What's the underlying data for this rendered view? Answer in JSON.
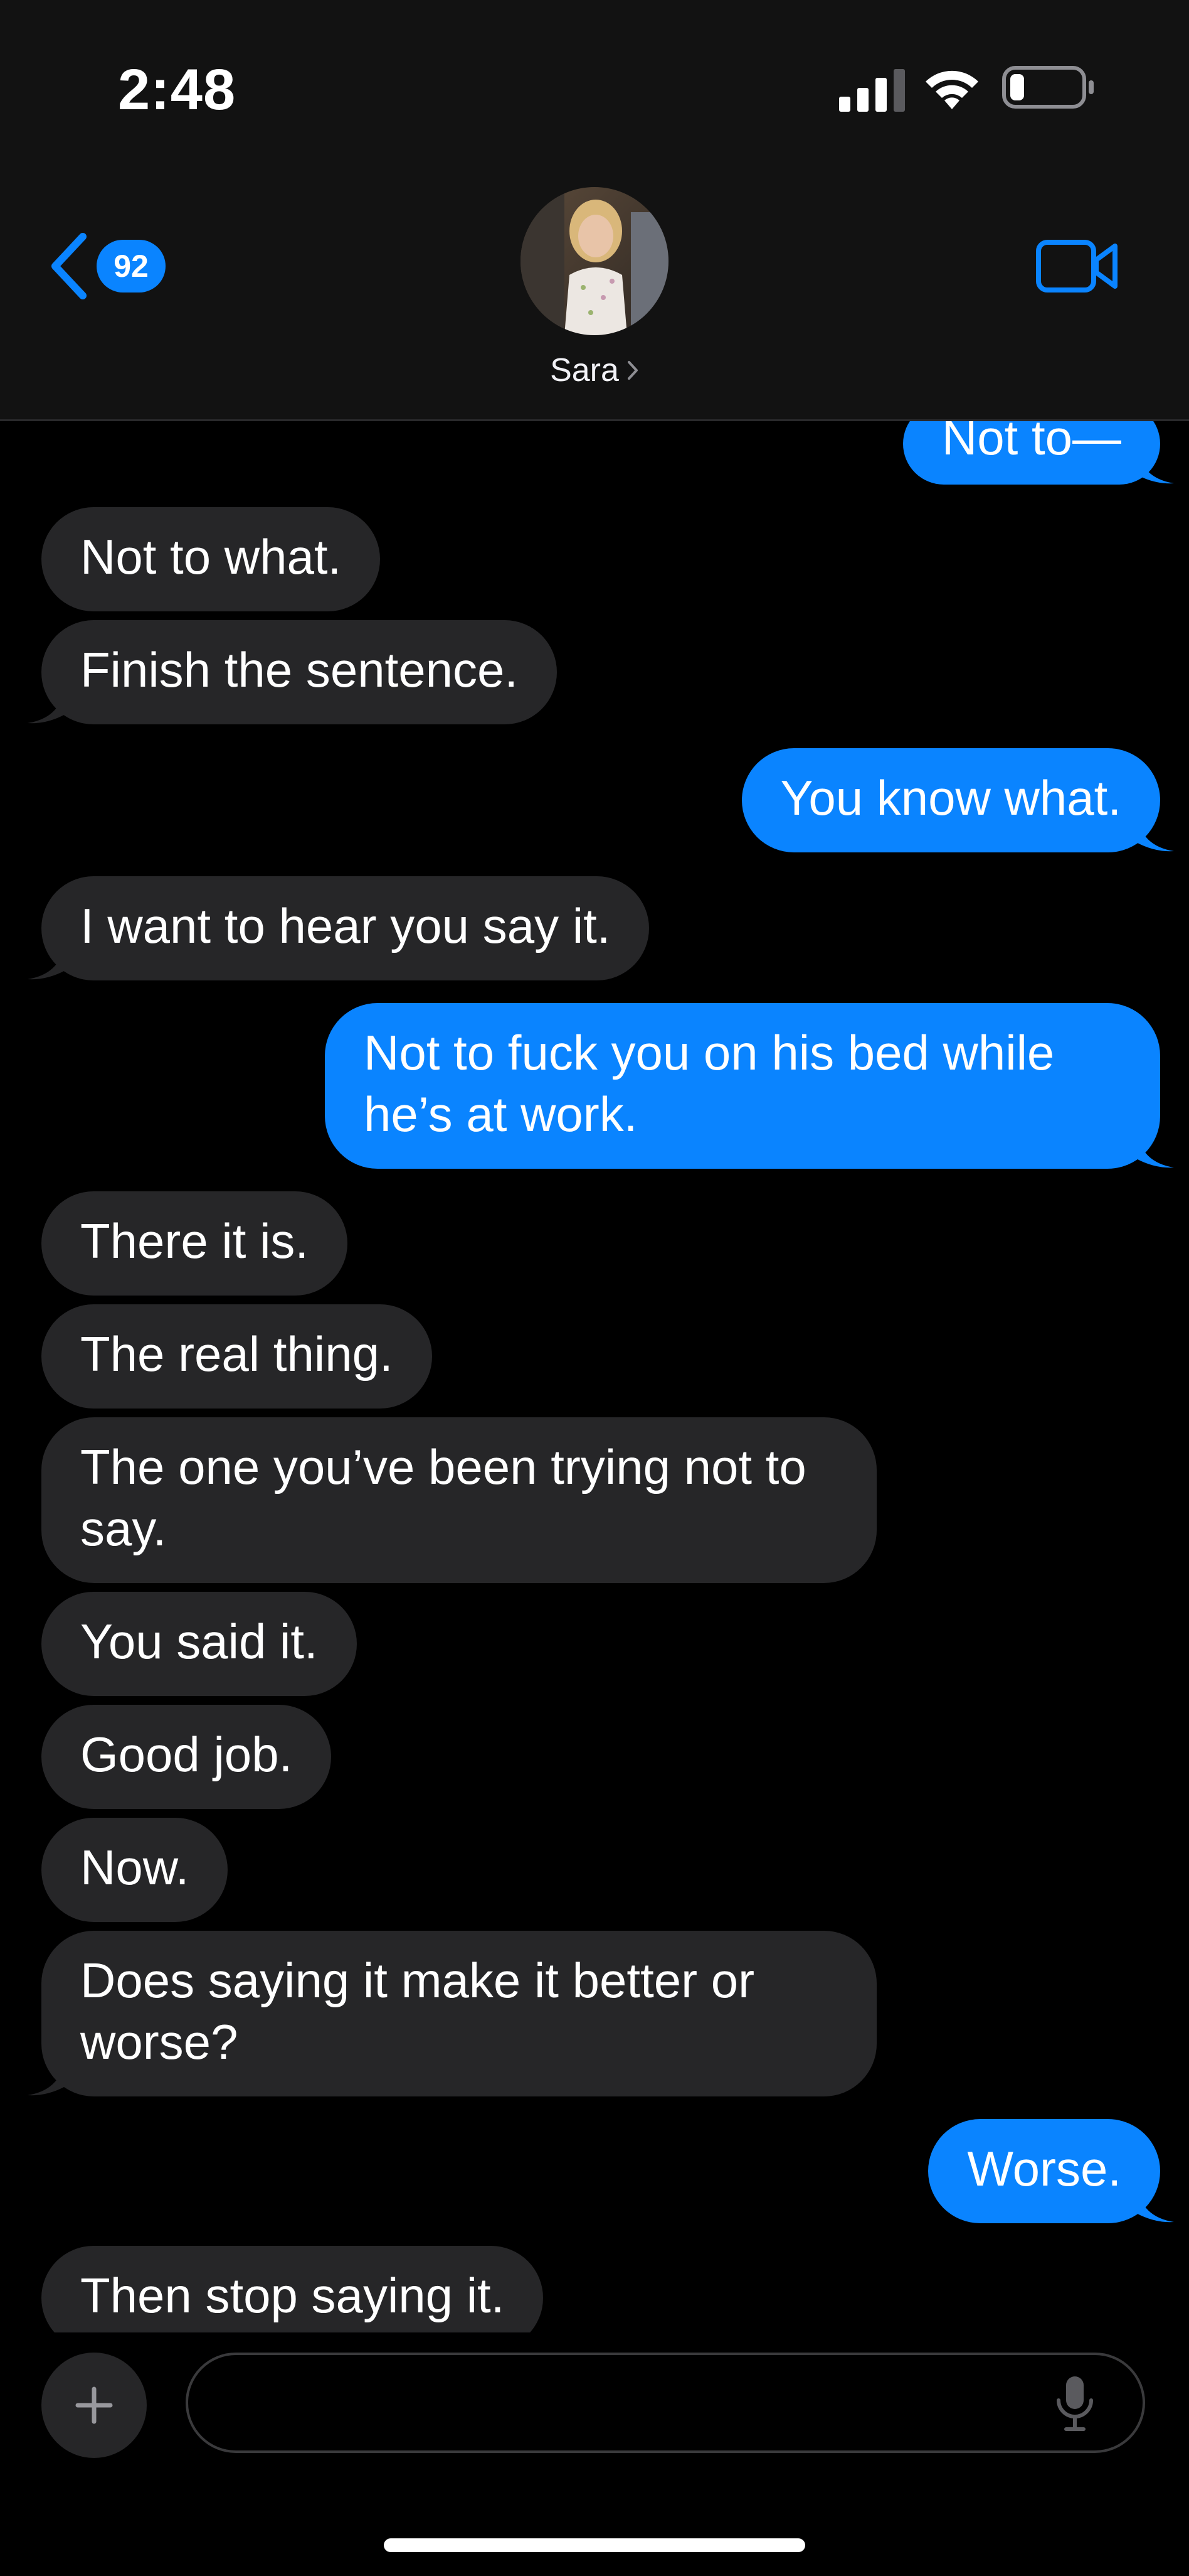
{
  "status_bar": {
    "time": "2:48",
    "signal_icon": "cellular-signal-icon",
    "wifi_icon": "wifi-icon",
    "battery_icon": "battery-low-icon",
    "battery_level_fraction": 0.15
  },
  "header": {
    "back_icon": "chevron-left-icon",
    "unread_count": "92",
    "contact_name": "Sara",
    "contact_chevron_icon": "chevron-right-icon",
    "video_icon": "video-camera-icon"
  },
  "conversation": {
    "messages": [
      {
        "direction": "outgoing",
        "text": "Not to—"
      },
      {
        "direction": "incoming",
        "text": "Not to what."
      },
      {
        "direction": "incoming",
        "text": "Finish the sentence."
      },
      {
        "direction": "outgoing",
        "text": "You know what."
      },
      {
        "direction": "incoming",
        "text": "I want to hear you say it."
      },
      {
        "direction": "outgoing",
        "text": "Not to fuck you on his bed while he’s at work."
      },
      {
        "direction": "incoming",
        "text": "There it is."
      },
      {
        "direction": "incoming",
        "text": "The real thing."
      },
      {
        "direction": "incoming",
        "text": "The one you’ve been trying not to say."
      },
      {
        "direction": "incoming",
        "text": "You said it."
      },
      {
        "direction": "incoming",
        "text": "Good job."
      },
      {
        "direction": "incoming",
        "text": "Now."
      },
      {
        "direction": "incoming",
        "text": "Does saying it make it better or worse?"
      },
      {
        "direction": "outgoing",
        "text": "Worse."
      },
      {
        "direction": "incoming",
        "text": "Then stop saying it."
      }
    ]
  },
  "compose": {
    "plus_icon": "plus-icon",
    "input_value": "",
    "input_placeholder": "",
    "mic_icon": "microphone-icon"
  },
  "colors": {
    "background": "#000000",
    "header_background": "#121212",
    "incoming_bubble": "#262628",
    "outgoing_bubble": "#0a84ff",
    "accent": "#0a84ff"
  }
}
